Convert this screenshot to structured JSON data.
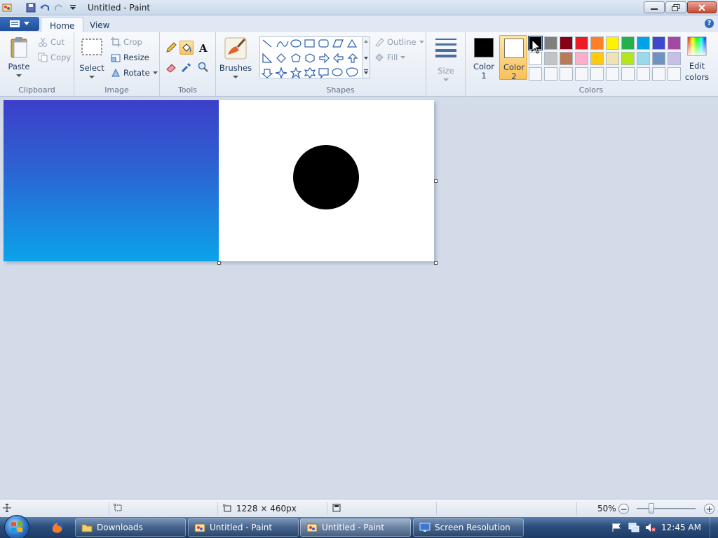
{
  "window": {
    "title": "Untitled - Paint"
  },
  "tabs": [
    {
      "label": "Home",
      "active": true
    },
    {
      "label": "View",
      "active": false
    }
  ],
  "ribbon": {
    "clipboard": {
      "group": "Clipboard",
      "paste": "Paste",
      "cut": "Cut",
      "copy": "Copy"
    },
    "image": {
      "group": "Image",
      "select": "Select",
      "crop": "Crop",
      "resize": "Resize",
      "rotate": "Rotate"
    },
    "tools": {
      "group": "Tools"
    },
    "brushes": {
      "label": "Brushes"
    },
    "shapes": {
      "group": "Shapes",
      "outline": "Outline",
      "fill": "Fill"
    },
    "size": {
      "label": "Size"
    },
    "colors": {
      "group": "Colors",
      "color1_label": "Color",
      "color1_num": "1",
      "color2_label": "Color",
      "color2_num": "2",
      "edit_label": "Edit",
      "edit_label2": "colors",
      "color1_value": "#000000",
      "color2_value": "#ffffff",
      "palette_row1": [
        "#000000",
        "#7f7f7f",
        "#880015",
        "#ed1c24",
        "#ff7f27",
        "#fff200",
        "#22b14c",
        "#00a2e8",
        "#3f48cc",
        "#a349a4"
      ],
      "palette_row2": [
        "#ffffff",
        "#c3c3c3",
        "#b97a57",
        "#ffaec9",
        "#ffc90e",
        "#efe4b0",
        "#b5e61d",
        "#99d9ea",
        "#7092be",
        "#c8bfe7"
      ],
      "palette_row3": [
        "#f5f7fa",
        "#f5f7fa",
        "#f5f7fa",
        "#f5f7fa",
        "#f5f7fa",
        "#f5f7fa",
        "#f5f7fa",
        "#f5f7fa",
        "#f5f7fa",
        "#f5f7fa"
      ]
    }
  },
  "status": {
    "dimensions": "1228 × 460px",
    "zoom": "50%"
  },
  "taskbar": {
    "buttons": [
      {
        "label": "Downloads",
        "active": false
      },
      {
        "label": "Untitled - Paint",
        "active": false
      },
      {
        "label": "Untitled - Paint",
        "active": true
      },
      {
        "label": "Screen Resolution",
        "active": false
      }
    ],
    "clock": "12:45 AM"
  }
}
